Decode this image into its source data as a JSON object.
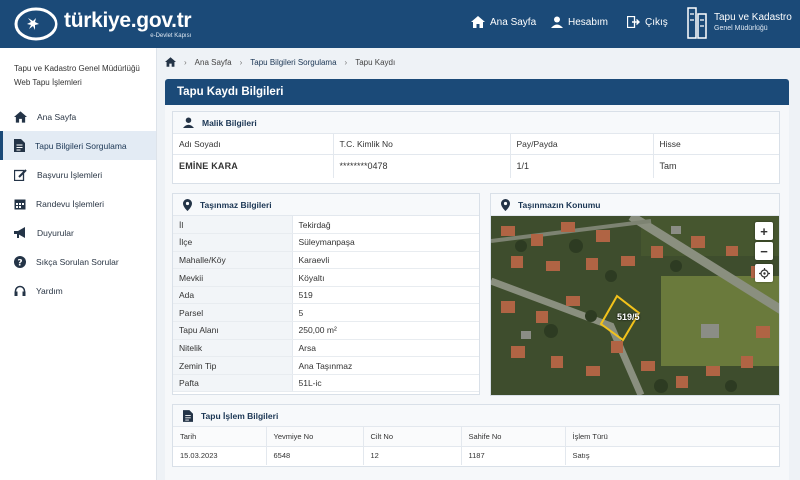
{
  "header": {
    "brand_title": "türkiye.gov.tr",
    "brand_sub": "e-Devlet Kapısı",
    "nav": [
      {
        "label": "Ana Sayfa",
        "icon": "home-icon"
      },
      {
        "label": "Hesabım",
        "icon": "user-icon"
      },
      {
        "label": "Çıkış",
        "icon": "logout-icon"
      }
    ],
    "tkgm_title": "Tapu ve Kadastro",
    "tkgm_sub": "Genel Müdürlüğü"
  },
  "sidebar": {
    "heading_line1": "Tapu ve Kadastro Genel Müdürlüğü",
    "heading_line2": "Web Tapu İşlemleri",
    "items": [
      {
        "label": "Ana Sayfa",
        "icon": "home-icon"
      },
      {
        "label": "Tapu Bilgileri Sorgulama",
        "icon": "document-icon",
        "active": true
      },
      {
        "label": "Başvuru İşlemleri",
        "icon": "edit-icon"
      },
      {
        "label": "Randevu İşlemleri",
        "icon": "calendar-icon"
      },
      {
        "label": "Duyurular",
        "icon": "megaphone-icon"
      },
      {
        "label": "Sıkça Sorulan Sorular",
        "icon": "question-icon"
      },
      {
        "label": "Yardım",
        "icon": "headset-icon"
      }
    ]
  },
  "breadcrumb": [
    "Ana Sayfa",
    "Tapu Bilgileri Sorgulama",
    "Tapu Kaydı"
  ],
  "page_title": "Tapu Kaydı Bilgileri",
  "owner": {
    "section_title": "Malik Bilgileri",
    "headers": [
      "Adı Soyadı",
      "T.C. Kimlik No",
      "Pay/Payda",
      "Hisse"
    ],
    "row": [
      "EMİNE KARA",
      "********0478",
      "1/1",
      "Tam"
    ]
  },
  "property": {
    "section_title": "Taşınmaz Bilgileri",
    "rows": [
      {
        "k": "İl",
        "v": "Tekirdağ"
      },
      {
        "k": "İlçe",
        "v": "Süleymanpaşa"
      },
      {
        "k": "Mahalle/Köy",
        "v": "Karaevli"
      },
      {
        "k": "Mevkii",
        "v": "Köyaltı"
      },
      {
        "k": "Ada",
        "v": "519"
      },
      {
        "k": "Parsel",
        "v": "5"
      },
      {
        "k": "Tapu Alanı",
        "v": "250,00 m²"
      },
      {
        "k": "Nitelik",
        "v": "Arsa"
      },
      {
        "k": "Zemin Tip",
        "v": "Ana Taşınmaz"
      },
      {
        "k": "Pafta",
        "v": "51L-ic"
      }
    ]
  },
  "location": {
    "section_title": "Taşınmazın Konumu",
    "parcel_label": "519/5",
    "zoom_in": "+",
    "zoom_out": "−"
  },
  "transactions": {
    "section_title": "Tapu İşlem Bilgileri",
    "headers": [
      "Tarih",
      "Yevmiye No",
      "Cilt No",
      "Sahife No",
      "İşlem Türü"
    ],
    "row": [
      "15.03.2023",
      "6548",
      "12",
      "1187",
      "Satış"
    ]
  },
  "colors": {
    "primary": "#1b4a78",
    "parcel": "#f2c21b"
  }
}
